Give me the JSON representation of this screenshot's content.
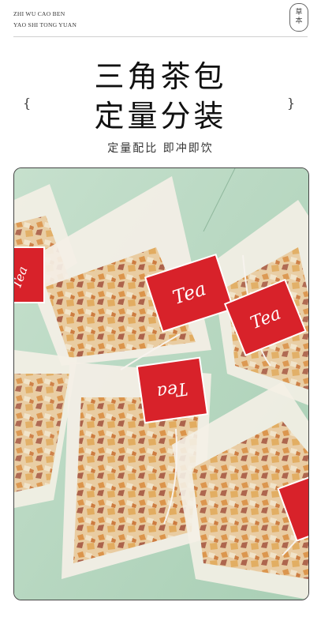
{
  "brand": {
    "line1": "ZHI WU CAO BEN",
    "line2": "YAO SHI TONG YUAN"
  },
  "seal": {
    "char1": "草",
    "char2": "本"
  },
  "heading": {
    "line1": "三角茶包",
    "line2": "定量分装",
    "brace_left": "{",
    "brace_right": "}"
  },
  "subtitle": "定量配比  即冲即饮",
  "photo": {
    "tag_label": "Tea",
    "bag_color": "#f4efe6",
    "tag_color": "#d8222a",
    "background_color": "#bcd9c6"
  }
}
